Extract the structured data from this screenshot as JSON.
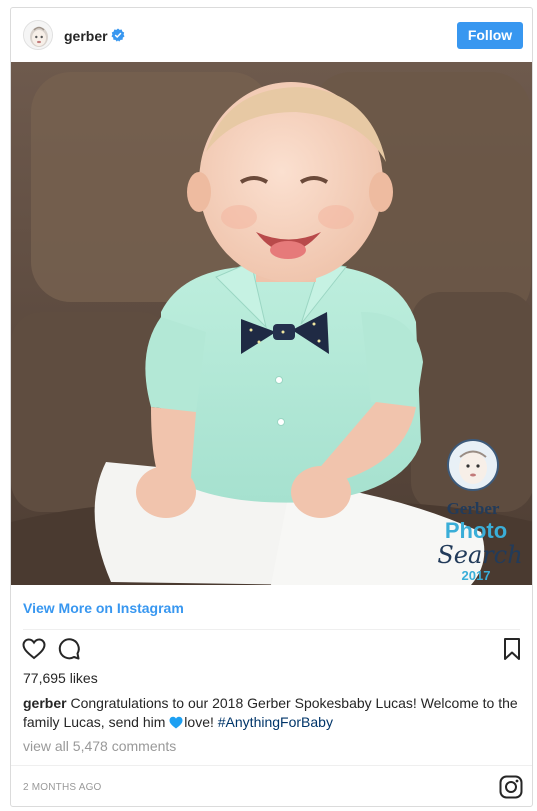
{
  "header": {
    "username": "gerber",
    "verified_color": "#3897f0",
    "follow_label": "Follow",
    "follow_color": "#3897f0"
  },
  "photo": {
    "overlay": {
      "brand": "Gerber",
      "word1": "Photo",
      "word2": "Search",
      "year": "2017"
    }
  },
  "view_more_label": "View More on Instagram",
  "actions": {
    "icons": [
      "heart-icon",
      "comment-icon",
      "bookmark-icon"
    ]
  },
  "likes": "77,695 likes",
  "caption": {
    "user": "gerber",
    "text_before": "Congratulations to our 2018 Gerber Spokesbaby Lucas! Welcome to the family Lucas, send him",
    "text_after": "love!",
    "hashtag": "#AnythingForBaby",
    "heart_color": "#1da0f2"
  },
  "comments_link": "view all 5,478 comments",
  "timestamp": "2 MONTHS AGO",
  "accent_color": "#3897f0"
}
